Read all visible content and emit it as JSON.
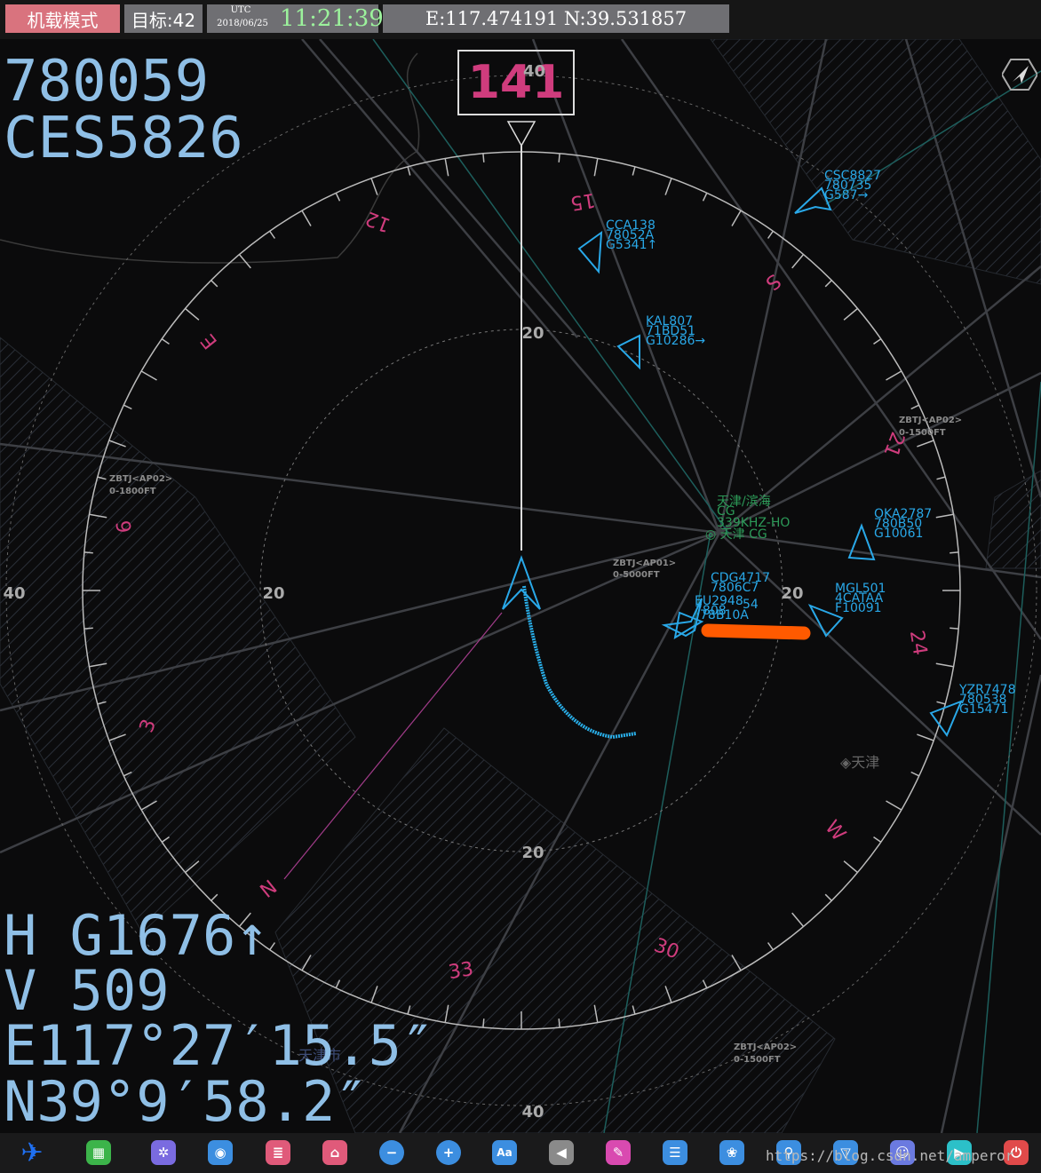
{
  "topbar": {
    "mode": "机载模式",
    "targets": "目标:42",
    "utc_label": "UTC",
    "date": "2018/06/25",
    "time": "11:21:39",
    "coord": "E:117.474191 N:39.531857"
  },
  "aircraft": {
    "code": "780059",
    "callsign": "CES5826",
    "heading": "141",
    "heading_ghost": "40",
    "h": "H G1676↑",
    "v": "V 509",
    "lon": "E117°27′15.5″",
    "lat": "N39°9′58.2″"
  },
  "compass": {
    "marks": [
      "N",
      "3",
      "6",
      "E",
      "12",
      "15",
      "S",
      "21",
      "24",
      "W",
      "30",
      "33"
    ],
    "range_labels": {
      "r20_top": "20",
      "r20_bottom": "20",
      "r20_left": "20",
      "r20_right": "20",
      "r40_left": "40",
      "r40_bottom": "40"
    }
  },
  "targets": [
    {
      "l1": "CSC8827",
      "l2": "780735",
      "l3": "G587→"
    },
    {
      "l1": "CCA138",
      "l2": "78052A",
      "l3": "G5341↑"
    },
    {
      "l1": "KAL807",
      "l2": "71BD51",
      "l3": "G10286→"
    },
    {
      "l1": "OKA2787",
      "l2": "780B50",
      "l3": "G10061"
    },
    {
      "l1": "MGL501",
      "l2": "4CATAA",
      "l3": "F10091"
    },
    {
      "l1": "YZR7478",
      "l2": "780538",
      "l3": "G15471"
    },
    {
      "l1": "CDG4717",
      "l2": "7806C7",
      "l3": ""
    },
    {
      "l1": "EU2948",
      "l2": "7808",
      "l3": "54"
    },
    {
      "l1": "78B10A",
      "l2": "",
      "l3": ""
    }
  ],
  "airspace": [
    {
      "l1": "ZBTJ<AP02>",
      "l2": "0-1500FT"
    },
    {
      "l1": "ZBTJ<AP02>",
      "l2": "0-1800FT"
    },
    {
      "l1": "ZBTJ<AP01>",
      "l2": "0-5000FT"
    },
    {
      "l1": "ZBTJ<AP02>",
      "l2": "0-1500FT"
    }
  ],
  "places": {
    "airport_l1": "天津/滨海",
    "airport_l2": "CG",
    "airport_l3": "339KHZ-HO",
    "airport_l4": "◎ 天津 CG",
    "city": "◈天津",
    "city2": "天津市"
  },
  "watermark": "https://blog.csdn.net/amperor",
  "colors": {
    "target": "#29a8e8",
    "compass": "#cf3c7d",
    "track": "#29aee8",
    "highlight": "#ff5a00"
  }
}
